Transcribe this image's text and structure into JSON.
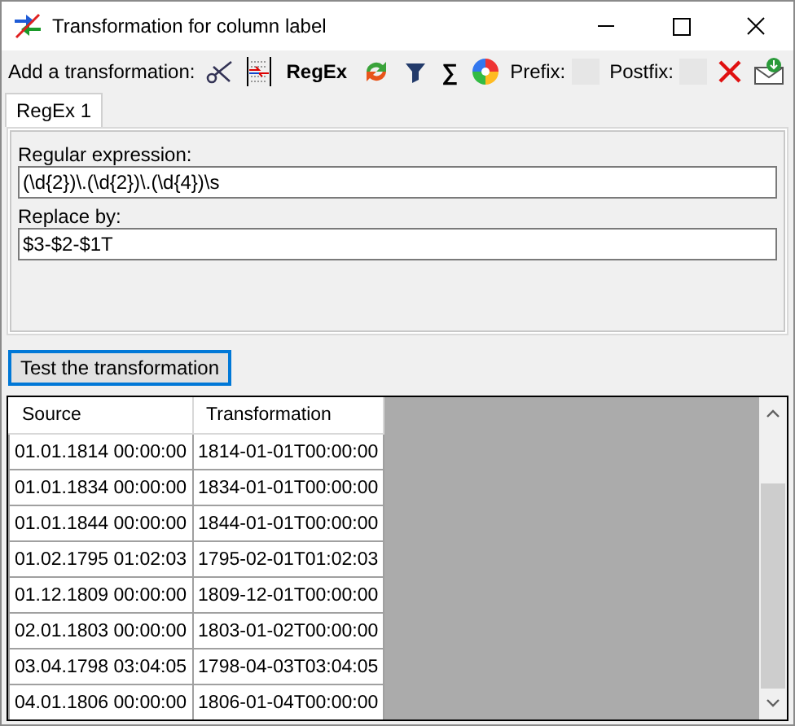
{
  "window": {
    "title": "Transformation for column label"
  },
  "toolbar": {
    "label": "Add a transformation:",
    "regex_button": "RegEx",
    "sum_button": "∑",
    "prefix": {
      "label": "Prefix:"
    },
    "postfix": {
      "label": "Postfix:"
    }
  },
  "tabs": [
    {
      "label": "RegEx 1",
      "selected": true
    }
  ],
  "fields": [
    {
      "label": "Regular expression:",
      "value": "(\\d{2})\\.(\\d{2})\\.(\\d{4})\\s"
    },
    {
      "label": "Replace by:",
      "value": "$3-$2-$1T"
    }
  ],
  "test_button": "Test the transformation",
  "grid": {
    "columns": [
      "Source",
      "Transformation"
    ],
    "rows": [
      [
        "01.01.1814 00:00:00",
        "1814-01-01T00:00:00"
      ],
      [
        "01.01.1834 00:00:00",
        "1834-01-01T00:00:00"
      ],
      [
        "01.01.1844 00:00:00",
        "1844-01-01T00:00:00"
      ],
      [
        "01.02.1795 01:02:03",
        "1795-02-01T01:02:03"
      ],
      [
        "01.12.1809 00:00:00",
        "1809-12-01T00:00:00"
      ],
      [
        "02.01.1803 00:00:00",
        "1803-01-02T00:00:00"
      ],
      [
        "03.04.1798 03:04:05",
        "1798-04-03T03:04:05"
      ],
      [
        "04.01.1806 00:00:00",
        "1806-01-04T00:00:00"
      ]
    ]
  }
}
